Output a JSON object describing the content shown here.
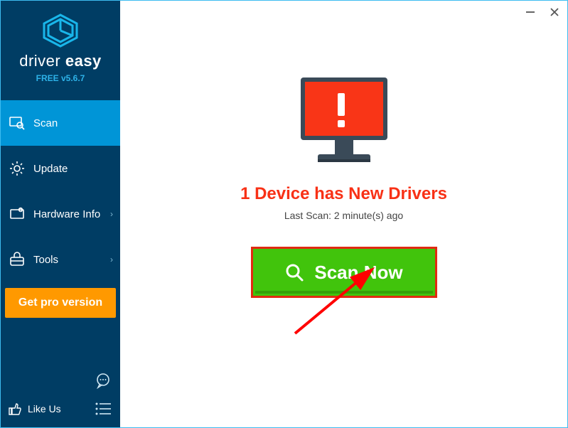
{
  "brand": {
    "name_a": "driver",
    "name_b": "easy",
    "version": "FREE v5.6.7"
  },
  "sidebar": {
    "items": [
      {
        "label": "Scan"
      },
      {
        "label": "Update"
      },
      {
        "label": "Hardware Info"
      },
      {
        "label": "Tools"
      }
    ],
    "pro_label": "Get pro version",
    "like_label": "Like Us"
  },
  "main": {
    "headline": "1 Device has New Drivers",
    "last_scan": "Last Scan: 2 minute(s) ago",
    "scan_button": "Scan Now"
  },
  "colors": {
    "sidebar_bg": "#003d64",
    "active_bg": "#0095d7",
    "accent_orange": "#ff9900",
    "alert_red": "#f83116",
    "scan_green": "#41c40c",
    "scan_border": "#e02a12"
  }
}
